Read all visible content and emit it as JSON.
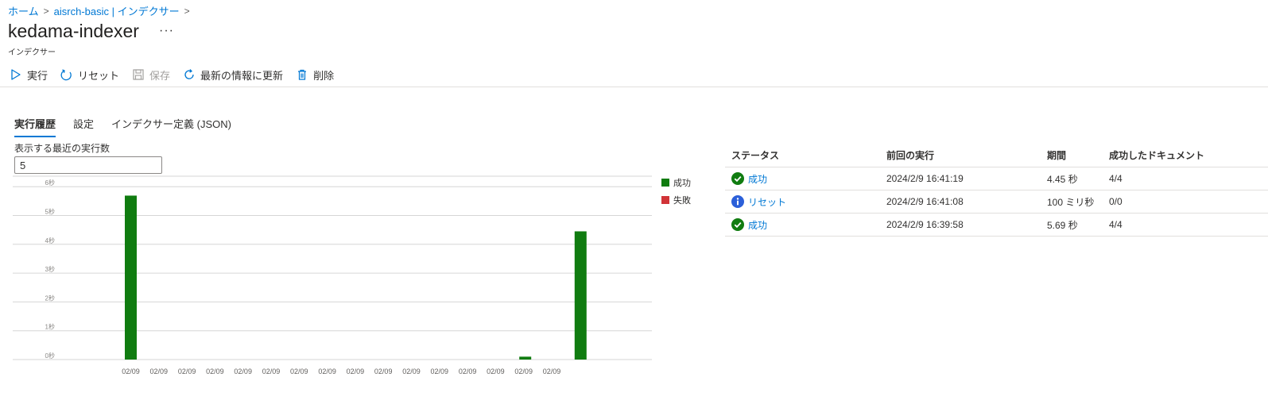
{
  "breadcrumb": {
    "home": "ホーム",
    "service": "aisrch-basic | インデクサー"
  },
  "header": {
    "title": "kedama-indexer",
    "more": "···",
    "subtitle": "インデクサー"
  },
  "toolbar": {
    "run": "実行",
    "reset": "リセット",
    "save": "保存",
    "refresh": "最新の情報に更新",
    "delete": "削除"
  },
  "tabs": [
    {
      "label": "実行履歴",
      "active": true
    },
    {
      "label": "設定",
      "active": false
    },
    {
      "label": "インデクサー定義 (JSON)",
      "active": false
    }
  ],
  "run_count": {
    "label": "表示する最近の実行数",
    "value": "5"
  },
  "colors": {
    "success": "#107c10",
    "failure": "#d13438",
    "accent": "#0078d4",
    "info": "#2b5fd9"
  },
  "chart_data": {
    "type": "bar",
    "ylim": [
      0,
      6
    ],
    "y_ticks": [
      "0秒",
      "1秒",
      "2秒",
      "3秒",
      "4秒",
      "5秒",
      "6秒"
    ],
    "categories": [
      "02/09",
      "02/09",
      "02/09",
      "02/09",
      "02/09",
      "02/09",
      "02/09",
      "02/09",
      "02/09",
      "02/09",
      "02/09",
      "02/09",
      "02/09",
      "02/09",
      "02/09",
      "02/09"
    ],
    "series": [
      {
        "name": "成功",
        "color": "#107c10",
        "values": [
          5.69,
          0,
          0,
          0,
          0,
          0,
          0,
          0,
          0,
          0,
          0,
          0,
          0,
          0,
          0.1,
          0,
          4.45
        ]
      },
      {
        "name": "失敗",
        "color": "#d13438",
        "values": []
      }
    ],
    "legend_position": "right",
    "grid": true
  },
  "table": {
    "headers": [
      "ステータス",
      "前回の実行",
      "期間",
      "成功したドキュメント"
    ],
    "rows": [
      {
        "status": "成功",
        "icon": "success-check-icon",
        "last_run": "2024/2/9 16:41:19",
        "duration": "4.45 秒",
        "docs": "4/4"
      },
      {
        "status": "リセット",
        "icon": "info-icon",
        "last_run": "2024/2/9 16:41:08",
        "duration": "100 ミリ秒",
        "docs": "0/0"
      },
      {
        "status": "成功",
        "icon": "success-check-icon",
        "last_run": "2024/2/9 16:39:58",
        "duration": "5.69 秒",
        "docs": "4/4"
      }
    ]
  }
}
